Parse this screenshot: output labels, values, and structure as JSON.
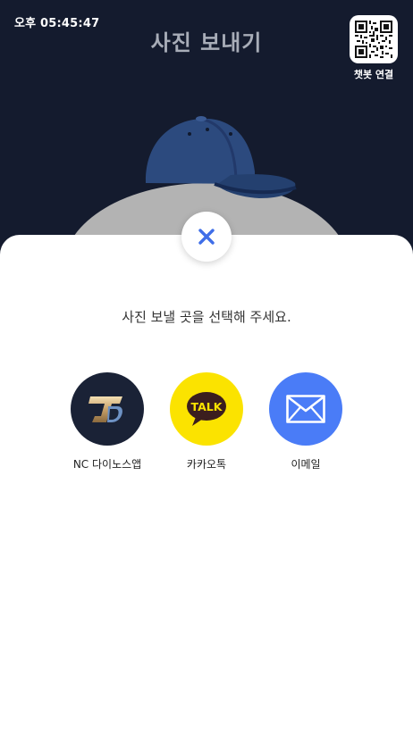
{
  "status": {
    "time": "오후 05:45:47"
  },
  "header": {
    "title": "사진 보내기"
  },
  "chatbot": {
    "label": "챗봇 연결"
  },
  "dialog": {
    "prompt": "사진 보낼 곳을 선택해 주세요."
  },
  "share_options": [
    {
      "label": "NC 다이노스앱",
      "icon": "nc-dinos-logo-icon",
      "color": "#1a2236"
    },
    {
      "label": "카카오톡",
      "icon": "kakaotalk-icon",
      "color": "#fbe300",
      "icon_text": "TALK"
    },
    {
      "label": "이메일",
      "icon": "email-icon",
      "color": "#4a7cf7"
    }
  ],
  "colors": {
    "background_dark": "#141b2e",
    "close_icon": "#3f6ee8",
    "cap": "#2c4a7e"
  }
}
